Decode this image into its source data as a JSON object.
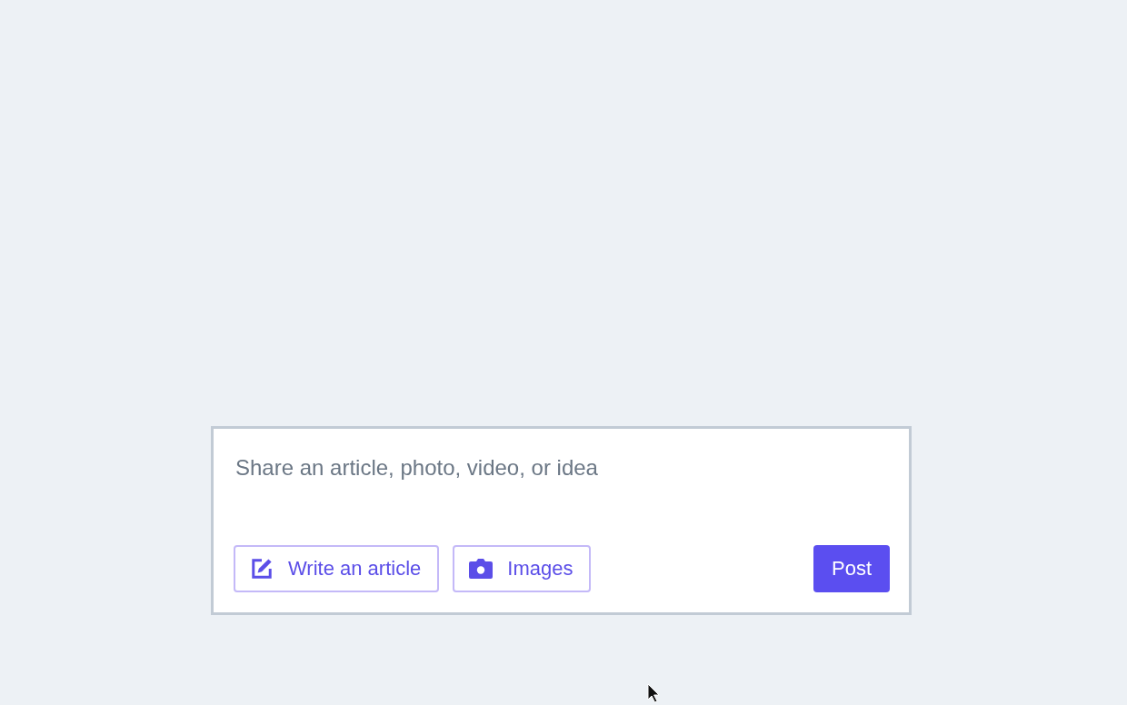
{
  "composer": {
    "placeholder": "Share an article, photo, video, or idea",
    "actions": [
      {
        "kind": "article",
        "label": "Write an article"
      },
      {
        "kind": "images",
        "label": "Images"
      }
    ],
    "submit": "Post"
  }
}
